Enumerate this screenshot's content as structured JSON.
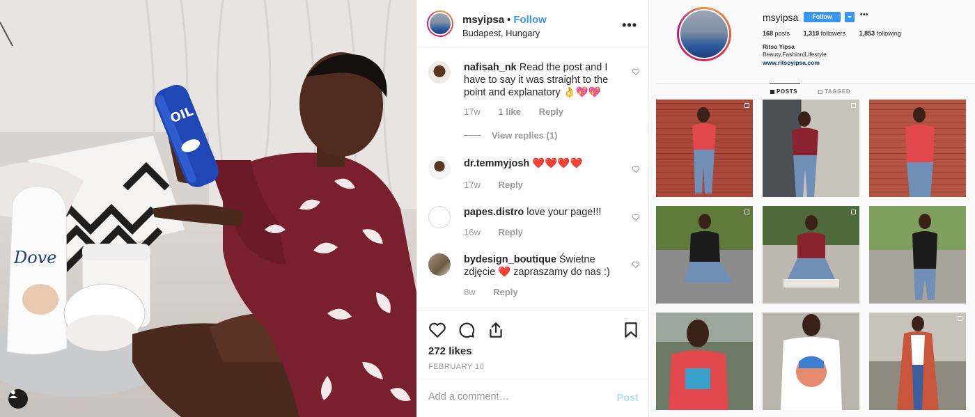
{
  "post": {
    "username": "msyipsa",
    "separator": "•",
    "follow_label": "Follow",
    "location": "Budapest, Hungary",
    "more_label": "•••",
    "comments": [
      {
        "username": "nafisah_nk",
        "text": "Read the post and I have to say it was straight to the point and explanatory 👌💖💖",
        "age": "17w",
        "likes": "1 like",
        "reply": "Reply"
      },
      {
        "username": "dr.temmyjosh",
        "text": "❤️❤️❤️❤️",
        "age": "17w",
        "reply": "Reply"
      },
      {
        "username": "papes.distro",
        "text": "love your page!!!",
        "age": "16w",
        "reply": "Reply"
      },
      {
        "username": "bydesign_boutique",
        "text": "Świetne zdjęcie ❤️ zapraszamy do nas :)",
        "age": "8w",
        "reply": "Reply"
      }
    ],
    "view_replies": "View replies (1)",
    "likes": "272 likes",
    "date": "FEBRUARY 10",
    "add_comment_placeholder": "Add a comment…",
    "post_button": "Post",
    "icons": [
      "heart-icon",
      "comment-icon",
      "share-icon",
      "bookmark-icon"
    ]
  },
  "profile": {
    "username": "msyipsa",
    "follow_label": "Follow",
    "more_label": "•••",
    "posts_count": "168",
    "posts_label": "posts",
    "followers_count": "1,319",
    "followers_label": "followers",
    "following_count": "1,853",
    "following_label": "following",
    "full_name": "Ritso Yipsa",
    "bio": "Beauty,Fashion|Lifestyle",
    "website": "www.ritsoyipsa.com",
    "tabs": [
      "POSTS",
      "TAGGED"
    ],
    "active_tab": "POSTS"
  },
  "colors": {
    "accent": "#3897f0",
    "robe": "#7a1f2e",
    "brick": "#a8473a",
    "nivea_blue": "#1f47b5"
  }
}
